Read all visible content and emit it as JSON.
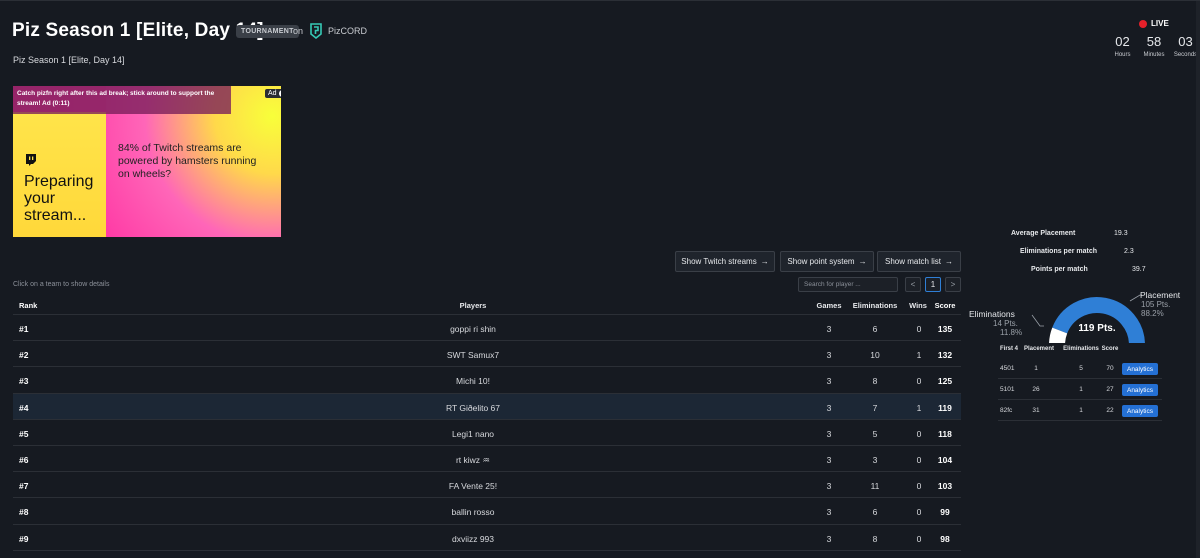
{
  "header": {
    "title": "Piz Season 1 [Elite, Day 14]",
    "badge": "TOURNAMENT",
    "on": "on",
    "org": "PizCORD",
    "subtitle": "Piz Season 1 [Elite, Day 14]"
  },
  "live": {
    "label": "LIVE",
    "hours": "02",
    "hours_label": "Hours",
    "minutes": "58",
    "minutes_label": "Minutes",
    "seconds": "03",
    "seconds_label": "Seconds"
  },
  "ad": {
    "banner": "Catch pizfn right after this ad break; stick around to support the stream! Ad (0:11)",
    "label": "Ad",
    "big_text": "Preparing your stream...",
    "fact": "84% of Twitch streams are powered by hamsters running on wheels?"
  },
  "buttons": {
    "twitch": "Show Twitch streams",
    "points": "Show point system",
    "matches": "Show match list"
  },
  "hint": "Click on a team to show details",
  "search": {
    "placeholder": "Search for player ..."
  },
  "pager": {
    "prev": "<",
    "page": "1",
    "next": ">"
  },
  "table": {
    "headers": {
      "rank": "Rank",
      "players": "Players",
      "games": "Games",
      "elims": "Eliminations",
      "wins": "Wins",
      "score": "Score"
    },
    "rows": [
      {
        "rank": "#1",
        "player": "goppi ri shin",
        "games": "3",
        "elims": "6",
        "wins": "0",
        "score": "135"
      },
      {
        "rank": "#2",
        "player": "SWT Samux7",
        "games": "3",
        "elims": "10",
        "wins": "1",
        "score": "132"
      },
      {
        "rank": "#3",
        "player": "Michi 10!",
        "games": "3",
        "elims": "8",
        "wins": "0",
        "score": "125"
      },
      {
        "rank": "#4",
        "player": "RT Giðelito 67",
        "games": "3",
        "elims": "7",
        "wins": "1",
        "score": "119"
      },
      {
        "rank": "#5",
        "player": "Legi1 nano",
        "games": "3",
        "elims": "5",
        "wins": "0",
        "score": "118"
      },
      {
        "rank": "#6",
        "player": "rt kiwz ♒",
        "games": "3",
        "elims": "3",
        "wins": "0",
        "score": "104"
      },
      {
        "rank": "#7",
        "player": "FA Vente 25!",
        "games": "3",
        "elims": "11",
        "wins": "0",
        "score": "103"
      },
      {
        "rank": "#8",
        "player": "ballin rosso",
        "games": "3",
        "elims": "6",
        "wins": "0",
        "score": "99"
      },
      {
        "rank": "#9",
        "player": "dxviizz 993",
        "games": "3",
        "elims": "8",
        "wins": "0",
        "score": "98"
      }
    ]
  },
  "details": {
    "avg_placement_label": "Average Placement",
    "avg_placement": "19.3",
    "elims_per_match_label": "Eliminations per match",
    "elims_per_match": "2.3",
    "points_per_match_label": "Points per match",
    "points_per_match": "39.7",
    "gauge": {
      "elims_label": "Eliminations",
      "elims_pts": "14 Pts.",
      "elims_pct": "11.8%",
      "placement_label": "Placement",
      "placement_pts": "105 Pts.",
      "placement_pct": "88.2%",
      "total": "119 Pts.",
      "placement_fraction": 0.882,
      "elims_fraction": 0.118,
      "colors": {
        "placement": "#2f7fd6",
        "elims": "#ffffff"
      }
    },
    "mini_headers": {
      "c1": "First 4",
      "c2": "Placement",
      "c3": "Eliminations",
      "c4": "Score"
    },
    "mini_rows": [
      {
        "id": "4501",
        "placement": "1",
        "elims": "5",
        "score": "70",
        "action": "Analytics"
      },
      {
        "id": "5101",
        "placement": "26",
        "elims": "1",
        "score": "27",
        "action": "Analytics"
      },
      {
        "id": "82fc",
        "placement": "31",
        "elims": "1",
        "score": "22",
        "action": "Analytics"
      }
    ]
  }
}
